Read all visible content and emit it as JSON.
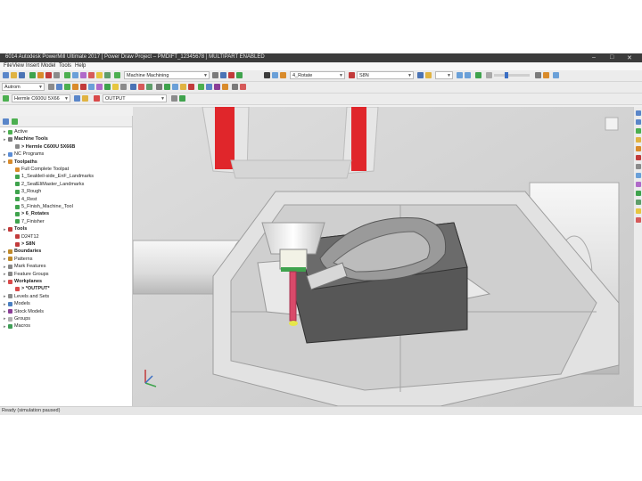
{
  "window": {
    "title": "6014 Autodesk PowerMill Ultimate 2017    [ Power Draw Project – PMDIFT_12345678 ]    MULTIPART ENABLED",
    "controls": [
      "–",
      "□",
      "✕"
    ]
  },
  "menu": [
    "File",
    "View",
    "Insert",
    "Model",
    "Tools",
    "Help"
  ],
  "toolbar": {
    "combo_machining": "Machine Machining",
    "combo_axis": "4_Rotate",
    "combo_tool": "S8N",
    "combo_setup": "Autrom",
    "combo_machine": "Hermle C600U 5X66",
    "combo_output": "OUTPUT"
  },
  "explorer": {
    "items": [
      {
        "label": "Active",
        "level": 0,
        "bold": false,
        "icon": "#4caf50"
      },
      {
        "label": "Machine Tools",
        "level": 0,
        "bold": true,
        "icon": "#7a7a7a"
      },
      {
        "label": "> Hermle C600U 5X66B",
        "level": 1,
        "bold": true,
        "icon": "#888888"
      },
      {
        "label": "NC Programs",
        "level": 0,
        "bold": false,
        "icon": "#5b8dd6"
      },
      {
        "label": "Toolpaths",
        "level": 0,
        "bold": true,
        "icon": "#d98b2b"
      },
      {
        "label": "Full Complete Toolpat",
        "level": 1,
        "bold": false,
        "icon": "#d98b2b"
      },
      {
        "label": "1_Sealdeil-side_EnF_Landmarks",
        "level": 1,
        "bold": false,
        "icon": "#3fa34d"
      },
      {
        "label": "2_SealEliMaster_Landmarks",
        "level": 1,
        "bold": false,
        "icon": "#3fa34d"
      },
      {
        "label": "3_Rough",
        "level": 1,
        "bold": false,
        "icon": "#3fa34d"
      },
      {
        "label": "4_Rest",
        "level": 1,
        "bold": false,
        "icon": "#3fa34d"
      },
      {
        "label": "5_Finish_Machine_Tool",
        "level": 1,
        "bold": false,
        "icon": "#3fa34d"
      },
      {
        "label": "> 6_Rotates",
        "level": 1,
        "bold": true,
        "icon": "#3fa34d"
      },
      {
        "label": "7_Finisher",
        "level": 1,
        "bold": false,
        "icon": "#3fa34d"
      },
      {
        "label": "Tools",
        "level": 0,
        "bold": true,
        "icon": "#c23b3b"
      },
      {
        "label": "D24T12",
        "level": 1,
        "bold": false,
        "icon": "#c23b3b"
      },
      {
        "label": "> S8N",
        "level": 1,
        "bold": true,
        "icon": "#c23b3b"
      },
      {
        "label": "Boundaries",
        "level": 0,
        "bold": true,
        "icon": "#c08a2a"
      },
      {
        "label": "Patterns",
        "level": 0,
        "bold": false,
        "icon": "#c08a2a"
      },
      {
        "label": "Mark Features",
        "level": 0,
        "bold": false,
        "icon": "#888888"
      },
      {
        "label": "Feature Groups",
        "level": 0,
        "bold": false,
        "icon": "#888888"
      },
      {
        "label": "Workplanes",
        "level": 0,
        "bold": true,
        "icon": "#d94a4a"
      },
      {
        "label": "> *OUTPUT*",
        "level": 1,
        "bold": true,
        "icon": "#d94a4a"
      },
      {
        "label": "Levels and Sets",
        "level": 0,
        "bold": false,
        "icon": "#8c8c8c"
      },
      {
        "label": "Models",
        "level": 0,
        "bold": false,
        "icon": "#4a7fc1"
      },
      {
        "label": "Stock Models",
        "level": 0,
        "bold": false,
        "icon": "#8b3e96"
      },
      {
        "label": "Groups",
        "level": 0,
        "bold": false,
        "icon": "#b0b0b0"
      },
      {
        "label": "Macros",
        "level": 0,
        "bold": false,
        "icon": "#3e9e56"
      }
    ]
  },
  "status": "Ready (simulation paused)",
  "colors": {
    "titlebar": "#3b3b3b",
    "machine_red": "#e0262b",
    "tool_pink": "#d94a6a",
    "part_dark": "#4a4a4a",
    "fixture_light": "#dcdcdc"
  }
}
